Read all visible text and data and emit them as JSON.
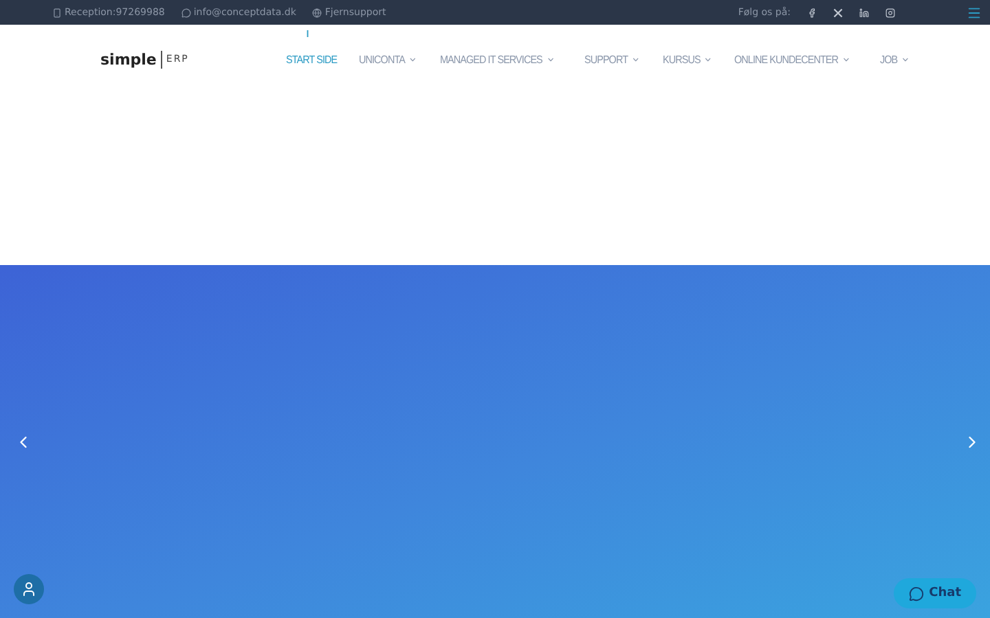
{
  "top_bar": {
    "contacts": [
      {
        "kind": "phone",
        "label": "Reception:97269988"
      },
      {
        "kind": "chat",
        "label": "info@conceptdata.dk"
      },
      {
        "kind": "globe",
        "label": "Fjernsupport"
      }
    ],
    "follow_label": "Følg os på:",
    "socials": [
      {
        "kind": "facebook"
      },
      {
        "kind": "x"
      },
      {
        "kind": "linkedin"
      },
      {
        "kind": "instagram"
      }
    ]
  },
  "logo": {
    "word": "simple",
    "suffix": "ERP"
  },
  "nav": [
    {
      "label": "START SIDE",
      "selected": true,
      "dropdown": false
    },
    {
      "label": "UNICONTA",
      "selected": false,
      "dropdown": true
    },
    {
      "label": "MANAGED IT SERVICES",
      "selected": false,
      "dropdown": true
    },
    {
      "label": "SUPPORT",
      "selected": false,
      "dropdown": true
    },
    {
      "label": "KURSUS",
      "selected": false,
      "dropdown": true
    },
    {
      "label": "ONLINE KUNDECENTER",
      "selected": false,
      "dropdown": true
    },
    {
      "label": "JOB",
      "selected": false,
      "dropdown": true
    }
  ],
  "chat_button": {
    "label": "Chat"
  }
}
